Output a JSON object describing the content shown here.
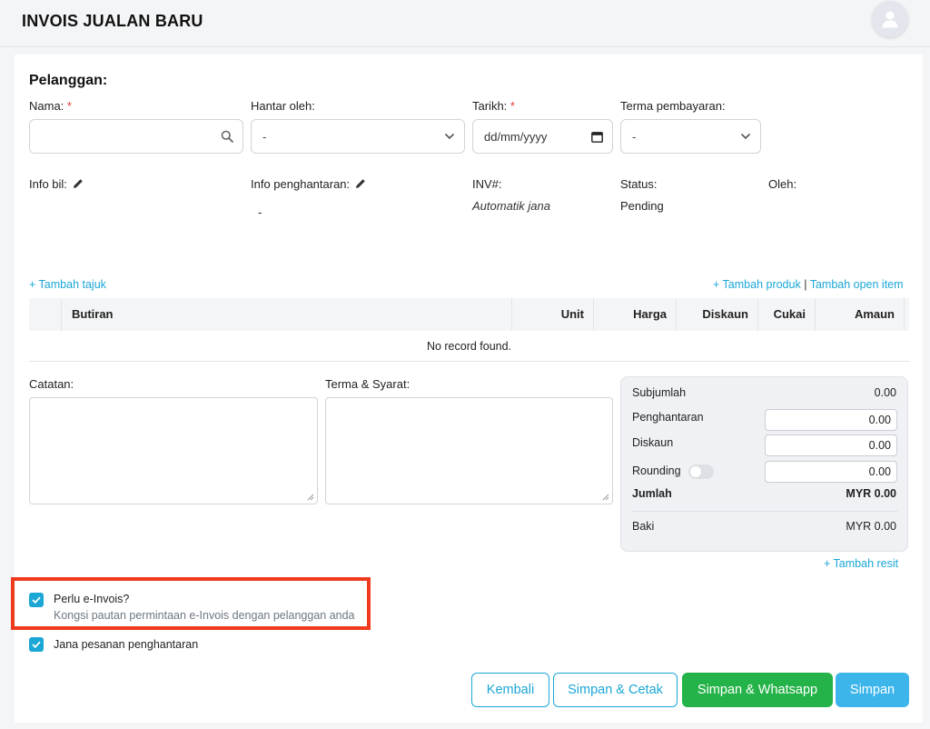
{
  "header": {
    "title": "INVOIS JUALAN BARU",
    "avatar_icon": "user-icon"
  },
  "customer": {
    "section_title": "Pelanggan:",
    "name_label": "Nama:",
    "required_mark": "*",
    "name_value": "",
    "deliver_by_label": "Hantar oleh:",
    "deliver_by_value": "-",
    "date_label": "Tarikh:",
    "date_placeholder": "dd/mm/yyyy",
    "payment_terms_label": "Terma pembayaran:",
    "payment_terms_value": "-"
  },
  "info": {
    "billing_label": "Info bil:",
    "delivery_label": "Info penghantaran:",
    "delivery_value": "-",
    "inv_label": "INV#:",
    "inv_value": "Automatik jana",
    "status_label": "Status:",
    "status_value": "Pending",
    "by_label": "Oleh:"
  },
  "items": {
    "add_heading_link": "+ Tambah tajuk",
    "add_product_link": "+ Tambah produk",
    "separator": "|",
    "add_open_item_link": "Tambah open item",
    "columns": [
      "Butiran",
      "Unit",
      "Harga",
      "Diskaun",
      "Cukai",
      "Amaun"
    ],
    "empty_text": "No record found."
  },
  "notes": {
    "notes_label": "Catatan:",
    "terms_label": "Terma & Syarat:"
  },
  "totals": {
    "subtotal_label": "Subjumlah",
    "subtotal_value": "0.00",
    "shipping_label": "Penghantaran",
    "shipping_value": "0.00",
    "discount_label": "Diskaun",
    "discount_value": "0.00",
    "rounding_label": "Rounding",
    "rounding_on": false,
    "rounding_value": "0.00",
    "total_label": "Jumlah",
    "total_value": "MYR 0.00",
    "balance_label": "Baki",
    "balance_value": "MYR 0.00",
    "add_receipt_link": "+ Tambah resit"
  },
  "options": {
    "einvoice_label": "Perlu e-Invois?",
    "einvoice_checked": true,
    "einvoice_hint": "Kongsi pautan permintaan e-Invois dengan pelanggan anda",
    "delivery_order_label": "Jana pesanan penghantaran",
    "delivery_order_checked": true
  },
  "actions": {
    "back_label": "Kembali",
    "save_print_label": "Simpan & Cetak",
    "save_whatsapp_label": "Simpan & Whatsapp",
    "save_label": "Simpan"
  },
  "colors": {
    "accent": "#1ba7d6",
    "green": "#24b348",
    "highlight": "#f03a1e",
    "required": "#e53935"
  }
}
